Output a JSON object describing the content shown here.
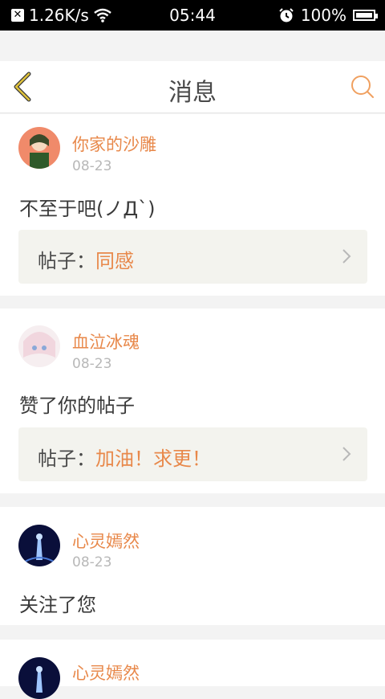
{
  "status_bar": {
    "speed": "1.26K/s",
    "time": "05:44",
    "battery": "100%"
  },
  "header": {
    "title": "消息"
  },
  "messages": [
    {
      "user": "你家的沙雕",
      "date": "08-23",
      "content": "不至于吧(ノД`)",
      "post_label": "帖子：",
      "post_title": "同感"
    },
    {
      "user": "血泣冰魂",
      "date": "08-23",
      "content": "赞了你的帖子",
      "post_label": "帖子：",
      "post_title": "加油！求更！"
    },
    {
      "user": "心灵嫣然",
      "date": "08-23",
      "content": "关注了您"
    },
    {
      "user": "心灵嫣然"
    }
  ],
  "colors": {
    "accent": "#e8884a",
    "back_arrow": "#e0c23a"
  }
}
